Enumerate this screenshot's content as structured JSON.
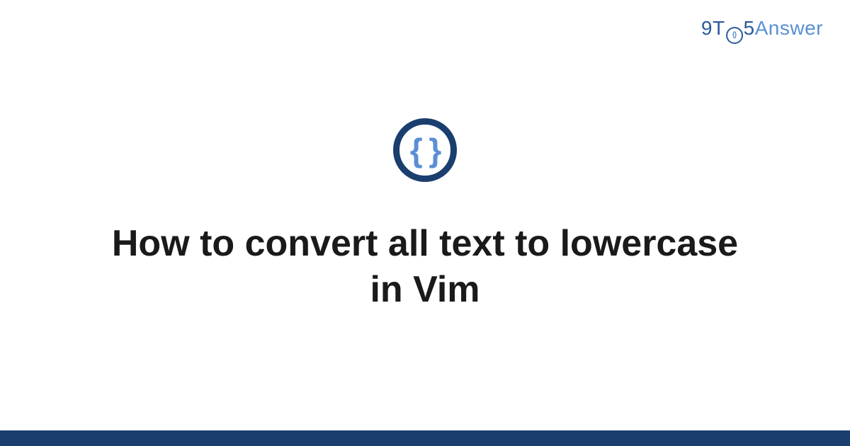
{
  "logo": {
    "part1": "9",
    "part2": "T",
    "part3": "5",
    "part4": "Answer"
  },
  "main": {
    "icon_name": "code-braces-icon",
    "title": "How to convert all text to lowercase in Vim"
  }
}
